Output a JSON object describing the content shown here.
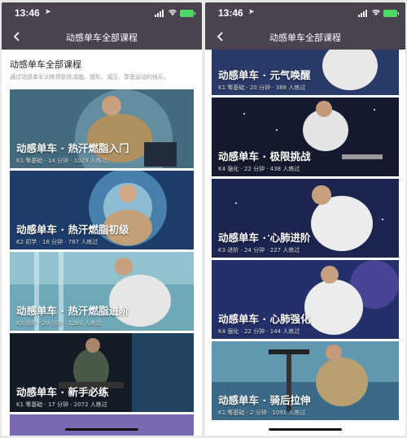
{
  "status_bar": {
    "time": "13:46"
  },
  "nav": {
    "title": "动感单车全部课程"
  },
  "intro": {
    "title": "动感单车全部课程",
    "description": "通过动感单车训练帮助你减脂、塑形、减压、享受运动的快乐。"
  },
  "left_courses": [
    {
      "title": "动感单车 · 热汗燃脂入门",
      "meta": "K1 零基础 · 14 分钟 · 1029 人练过"
    },
    {
      "title": "动感单车 · 热汗燃脂初级",
      "meta": "K2 初学 · 18 分钟 · 787 人练过"
    },
    {
      "title": "动感单车 · 热汗燃脂进阶",
      "meta": "K3 进阶 · 20 分钟 · 1280 人练过"
    },
    {
      "title": "动感单车 · 新手必练",
      "meta": "K1 零基础 · 17 分钟 · 2072 人练过"
    }
  ],
  "right_courses": [
    {
      "title": "动感单车 · 元气唤醒",
      "meta": "K1 零基础 · 20 分钟 · 388 人练过"
    },
    {
      "title": "动感单车 · 极限挑战",
      "meta": "K4 强化 · 22 分钟 · 438 人练过"
    },
    {
      "title": "动感单车 · 心肺进阶",
      "meta": "K3 进阶 · 24 分钟 · 227 人练过"
    },
    {
      "title": "动感单车 · 心肺强化",
      "meta": "K4 强化 · 22 分钟 · 144 人练过"
    },
    {
      "title": "动感单车 · 骑后拉伸",
      "meta": "K1 零基础 · 2 分钟 · 1091 人练过"
    }
  ],
  "colors": {
    "header": "#4b4250",
    "battery": "#4cd964"
  },
  "icons": {
    "back": "back-icon",
    "location": "location-arrow-icon",
    "signal": "signal-icon",
    "wifi": "wifi-icon",
    "battery": "battery-icon"
  }
}
